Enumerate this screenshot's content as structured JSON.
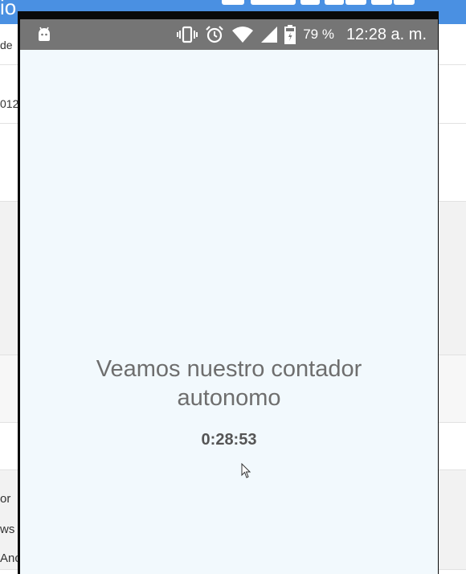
{
  "background": {
    "header_title": "io",
    "row_fragments": [
      "de",
      "012"
    ],
    "side_fragments": [
      "or",
      "ws",
      "Anc"
    ],
    "colors": {
      "header": "#4a90e2",
      "panel": "#f2f2f2"
    }
  },
  "status_bar": {
    "app_icon": "android-icon",
    "icons": [
      "vibrate-icon",
      "alarm-icon",
      "wifi-icon",
      "signal-icon",
      "battery-icon"
    ],
    "battery_percent": "79 %",
    "clock": "12:28 a. m."
  },
  "app": {
    "message_line1": "Veamos nuestro contador",
    "message_line2": "autonomo",
    "timer": "0:28:53",
    "background_color": "#f2f9fd",
    "status_bar_color": "#757575"
  }
}
